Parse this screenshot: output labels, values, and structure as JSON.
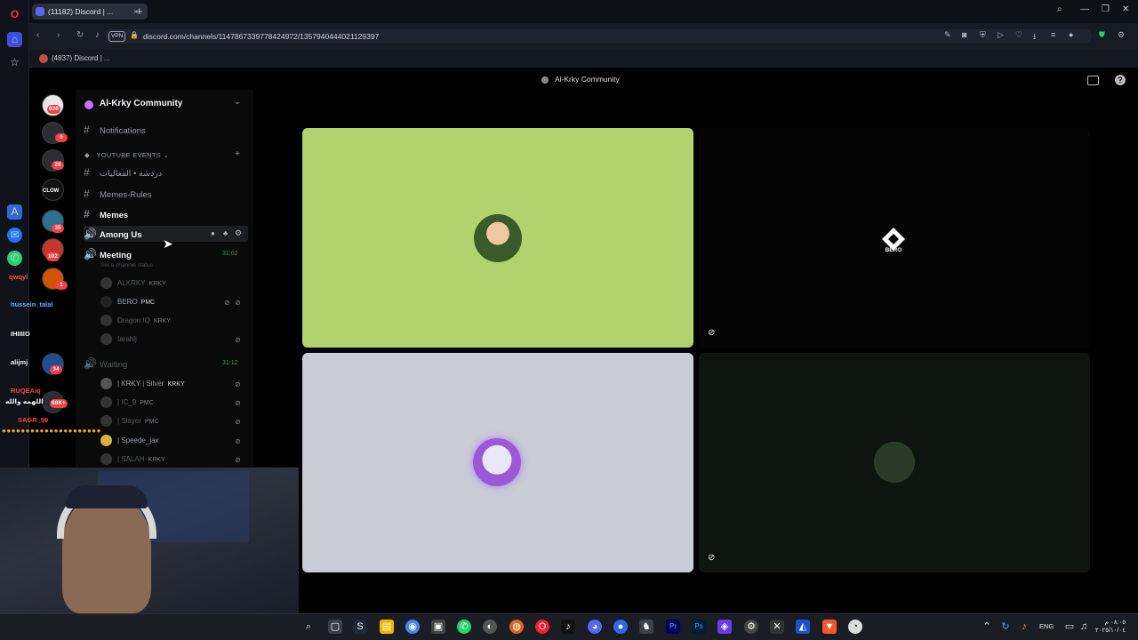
{
  "browser": {
    "tab_title": "(11182) Discord | ...",
    "url": "discord.com/channels/1147867339778424972/1357940444021129397",
    "vpn_label": "VPN",
    "bookmark": "(4837) Discord | ...",
    "new_tab": "+",
    "tab_close": "×"
  },
  "discord": {
    "window_title": "Al-Krky Community",
    "server_name": "Al-Krky Community",
    "category": "YOUTUBE EVENTS",
    "channels": [
      {
        "label": "Notifications"
      },
      {
        "label": "دردشة • الفعاليات"
      },
      {
        "label": "Memes-Rules"
      },
      {
        "label": "Memes"
      },
      {
        "label": "Among Us"
      },
      {
        "label": "Meeting",
        "time": "31:02"
      },
      {
        "label": "Waiting",
        "time": "31:12"
      }
    ],
    "channel_status_hint": "Set a channel status",
    "meeting_users": [
      {
        "name": "ALKRKY",
        "role": "KRKY"
      },
      {
        "name": "BERO",
        "role": "PMC"
      },
      {
        "name": "Dragon IQ",
        "role": "KRKY"
      },
      {
        "name": "farahlj",
        "role": ""
      }
    ],
    "waiting_users": [
      {
        "name": "| KRKY | Silver",
        "role": "KRKY"
      },
      {
        "name": "| IC_9",
        "role": "PMC"
      },
      {
        "name": "| Slayer",
        "role": "PMC"
      },
      {
        "name": "| Speede_jax",
        "role": ""
      },
      {
        "name": "| SALAH",
        "role": "KRKY"
      }
    ],
    "server_badges": [
      "626",
      "6",
      "28",
      "35",
      "102",
      "1",
      "34",
      "68K+"
    ],
    "server_labels": [
      "CLOW"
    ],
    "tiles": [
      {
        "name": "user-green"
      },
      {
        "name": "BERO",
        "logo_text": "BERO"
      },
      {
        "name": "user-purple"
      },
      {
        "name": "user-emblem"
      }
    ]
  },
  "overlay": {
    "chat": [
      {
        "text": "qwqyl",
        "color": "#ff5252"
      },
      {
        "text": "hussein_talal",
        "color": "#5ab0ff"
      },
      {
        "text": "IHIIIIO",
        "color": "#f2f3f5"
      },
      {
        "text": "alijmj",
        "color": "#f2f3f5"
      },
      {
        "text": "RUQEAiq",
        "color": "#ff4040"
      },
      {
        "text": "اللهمه والله",
        "color": "#f2f3f5"
      },
      {
        "text": "SAGR_99",
        "color": "#ff4040"
      }
    ]
  },
  "taskbar": {
    "lang": "ENG",
    "time": "٠٨:٠٥ م",
    "date": "٢٠٢٥/١٠/٠٤"
  },
  "colors": {
    "tile_green": "#b1d26c",
    "tile_gray": "#c9cbd5",
    "accent": "#5865f2",
    "badge_red": "#f23f43",
    "voice_green": "#23a55a"
  }
}
